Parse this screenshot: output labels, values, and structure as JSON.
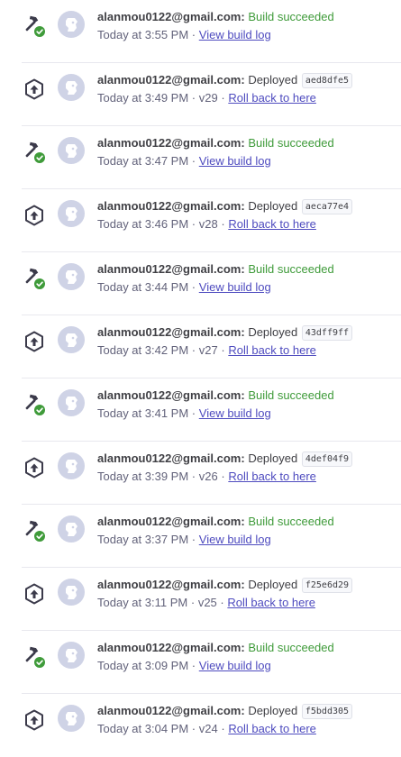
{
  "activity_feed": {
    "items": [
      {
        "type": "build",
        "icon": "hammer-success-icon",
        "user": "alanmou0122@gmail.com:",
        "status": "Build succeeded",
        "time": "Today at 3:55 PM",
        "separator": "·",
        "link_label": "View build log"
      },
      {
        "type": "deploy",
        "icon": "deploy-upload-icon",
        "user": "alanmou0122@gmail.com:",
        "status": "Deployed",
        "sha": "aed8dfe5",
        "time": "Today at 3:49 PM",
        "separator": "·",
        "version": "v29",
        "link_label": "Roll back to here"
      },
      {
        "type": "build",
        "icon": "hammer-success-icon",
        "user": "alanmou0122@gmail.com:",
        "status": "Build succeeded",
        "time": "Today at 3:47 PM",
        "separator": "·",
        "link_label": "View build log"
      },
      {
        "type": "deploy",
        "icon": "deploy-upload-icon",
        "user": "alanmou0122@gmail.com:",
        "status": "Deployed",
        "sha": "aeca77e4",
        "time": "Today at 3:46 PM",
        "separator": "·",
        "version": "v28",
        "link_label": "Roll back to here"
      },
      {
        "type": "build",
        "icon": "hammer-success-icon",
        "user": "alanmou0122@gmail.com:",
        "status": "Build succeeded",
        "time": "Today at 3:44 PM",
        "separator": "·",
        "link_label": "View build log"
      },
      {
        "type": "deploy",
        "icon": "deploy-upload-icon",
        "user": "alanmou0122@gmail.com:",
        "status": "Deployed",
        "sha": "43dff9ff",
        "time": "Today at 3:42 PM",
        "separator": "·",
        "version": "v27",
        "link_label": "Roll back to here"
      },
      {
        "type": "build",
        "icon": "hammer-success-icon",
        "user": "alanmou0122@gmail.com:",
        "status": "Build succeeded",
        "time": "Today at 3:41 PM",
        "separator": "·",
        "link_label": "View build log"
      },
      {
        "type": "deploy",
        "icon": "deploy-upload-icon",
        "user": "alanmou0122@gmail.com:",
        "status": "Deployed",
        "sha": "4def04f9",
        "time": "Today at 3:39 PM",
        "separator": "·",
        "version": "v26",
        "link_label": "Roll back to here"
      },
      {
        "type": "build",
        "icon": "hammer-success-icon",
        "user": "alanmou0122@gmail.com:",
        "status": "Build succeeded",
        "time": "Today at 3:37 PM",
        "separator": "·",
        "link_label": "View build log"
      },
      {
        "type": "deploy",
        "icon": "deploy-upload-icon",
        "user": "alanmou0122@gmail.com:",
        "status": "Deployed",
        "sha": "f25e6d29",
        "time": "Today at 3:11 PM",
        "separator": "·",
        "version": "v25",
        "link_label": "Roll back to here"
      },
      {
        "type": "build",
        "icon": "hammer-success-icon",
        "user": "alanmou0122@gmail.com:",
        "status": "Build succeeded",
        "time": "Today at 3:09 PM",
        "separator": "·",
        "link_label": "View build log"
      },
      {
        "type": "deploy",
        "icon": "deploy-upload-icon",
        "user": "alanmou0122@gmail.com:",
        "status": "Deployed",
        "sha": "f5bdd305",
        "time": "Today at 3:04 PM",
        "separator": "·",
        "version": "v24",
        "link_label": "Roll back to here"
      }
    ]
  },
  "colors": {
    "success_green": "#3f9b3a",
    "link_purple": "#4e4bbf",
    "icon_dark": "#3b3a4a",
    "avatar_fill": "#cfd3e6",
    "divider": "#e8e8ee"
  }
}
